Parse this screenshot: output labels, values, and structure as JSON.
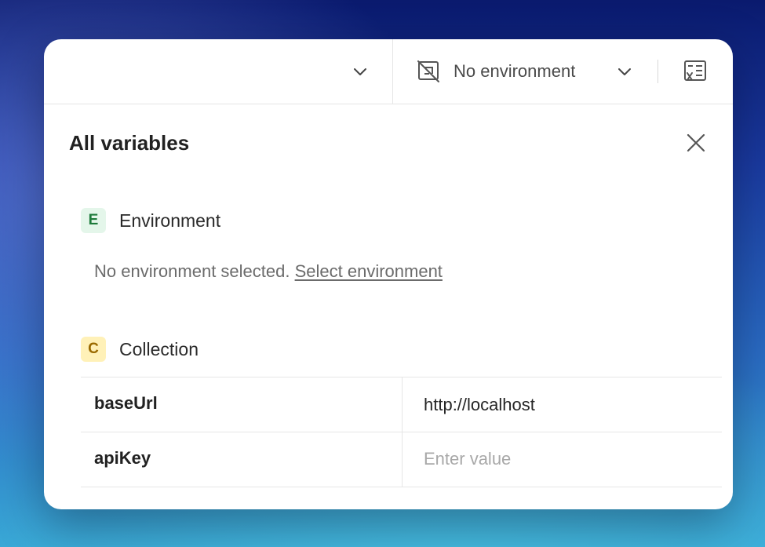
{
  "topbar": {
    "environment_label": "No environment"
  },
  "panel": {
    "title": "All variables"
  },
  "environment_section": {
    "badge": "E",
    "label": "Environment",
    "empty_message": "No environment selected.",
    "select_link": "Select environment"
  },
  "collection_section": {
    "badge": "C",
    "label": "Collection",
    "variables": [
      {
        "key": "baseUrl",
        "value": "http://localhost",
        "placeholder": ""
      },
      {
        "key": "apiKey",
        "value": "",
        "placeholder": "Enter value"
      }
    ]
  },
  "icons": {
    "dropdown": "chevron-down-icon",
    "environment": "no-environment-icon",
    "variables": "variables-icon",
    "close": "close-icon"
  },
  "colors": {
    "environment_badge_bg": "#e4f6ea",
    "environment_badge_text": "#1d7a3a",
    "collection_badge_bg": "#fff1b8",
    "collection_badge_text": "#9a6a00"
  }
}
